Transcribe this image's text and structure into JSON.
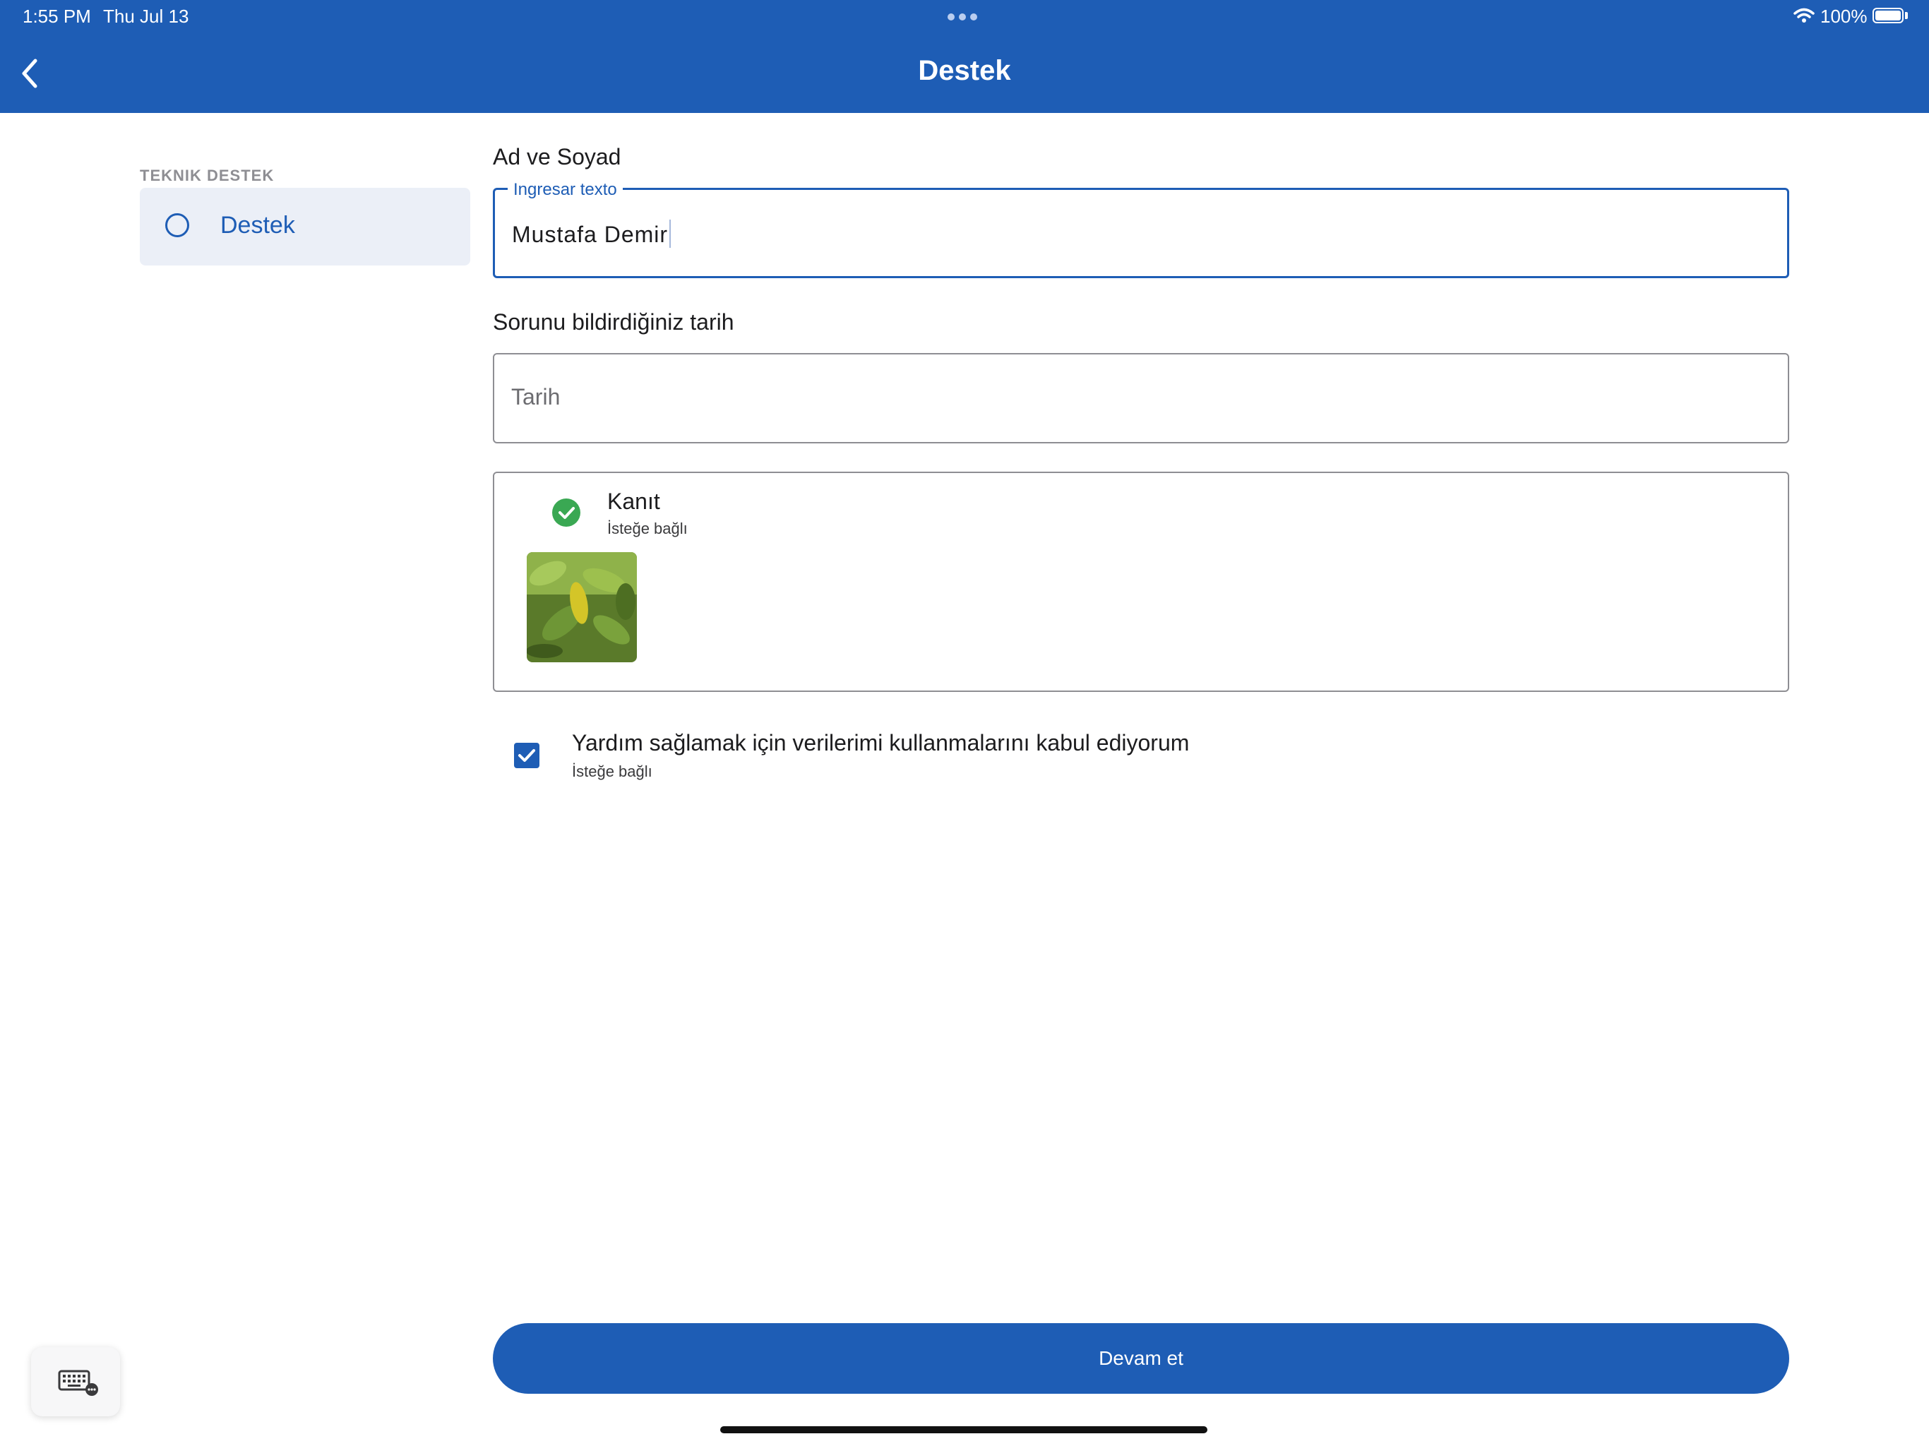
{
  "status_bar": {
    "time": "1:55 PM",
    "date": "Thu Jul 13",
    "battery": "100%"
  },
  "header": {
    "title": "Destek"
  },
  "sidebar": {
    "section_title": "TEKNIK DESTEK",
    "items": [
      {
        "label": "Destek"
      }
    ]
  },
  "form": {
    "name": {
      "label": "Ad ve Soyad",
      "floating_label": "Ingresar texto",
      "value": "Mustafa Demir"
    },
    "date": {
      "label": "Sorunu bildirdiğiniz tarih",
      "placeholder": "Tarih"
    },
    "evidence": {
      "title": "Kanıt",
      "subtitle": "İsteğe bağlı",
      "attachment": "leaf-photo"
    },
    "consent": {
      "text": "Yardım sağlamak için verilerimi kullanmalarını kabul ediyorum",
      "subtitle": "İsteğe bağlı",
      "checked": true
    }
  },
  "actions": {
    "continue_label": "Devam et"
  },
  "colors": {
    "primary": "#1e5db5",
    "success": "#3aa853",
    "sidebar_bg": "#ebeff7"
  }
}
